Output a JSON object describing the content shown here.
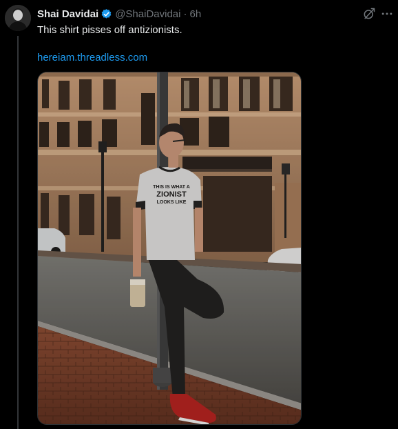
{
  "tweet": {
    "author": {
      "display_name": "Shai Davidai",
      "handle": "@ShaiDavidai",
      "verified": true,
      "avatar_icon": "profile-photo"
    },
    "separator": "·",
    "time": "6h",
    "text": "This shirt pisses off antizionists.",
    "link": "hereiam.threadless.com",
    "media": {
      "type": "photo",
      "shirt_text": [
        "THIS IS WHAT A",
        "ZIONIST",
        "LOOKS LIKE"
      ]
    }
  },
  "icons": {
    "grok": "grok-icon",
    "more": "more-icon",
    "verified": "verified-badge-icon"
  },
  "colors": {
    "background": "#000000",
    "text": "#e7e9ea",
    "secondary": "#71767b",
    "link": "#1d9bf0",
    "verified": "#1d9bf0"
  }
}
